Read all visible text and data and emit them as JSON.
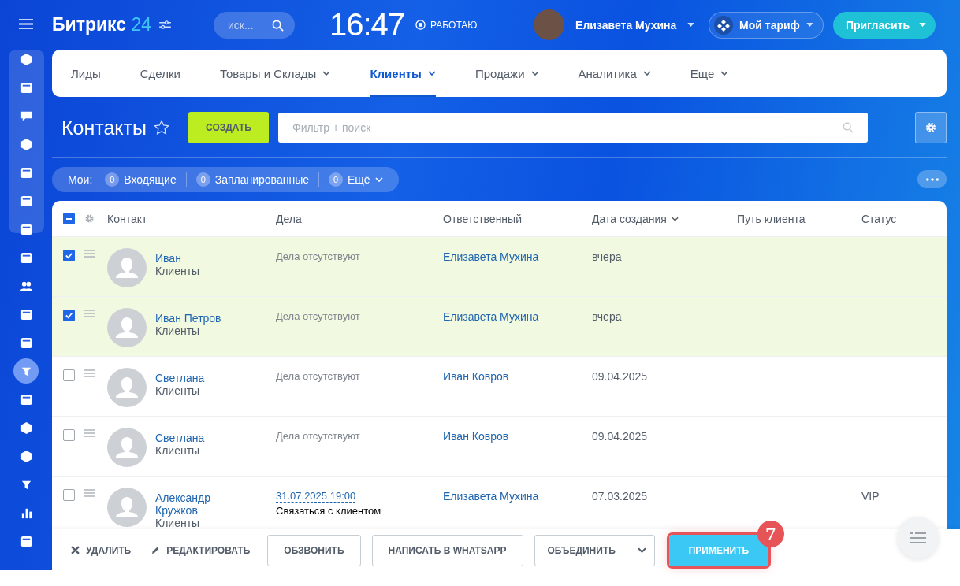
{
  "header": {
    "logo_name": "Битрикс",
    "logo_number": "24",
    "search": {
      "placeholder": "иск..."
    },
    "clock": "16:47",
    "work_status": "РАБОТАЮ",
    "user": {
      "name": "Елизавета Мухина"
    },
    "plan_button": "Мой тариф",
    "invite_button": "Пригласить"
  },
  "sidebar": {
    "items": [
      {
        "selected": false
      },
      {
        "selected": false
      },
      {
        "selected": false
      },
      {
        "selected": false
      },
      {
        "selected": false
      },
      {
        "selected": false
      },
      {
        "selected": false
      },
      {
        "selected": false
      },
      {
        "selected": false
      },
      {
        "selected": false
      },
      {
        "selected": false
      },
      {
        "selected": true
      },
      {
        "selected": false
      },
      {
        "selected": false
      },
      {
        "selected": false
      },
      {
        "selected": false
      },
      {
        "selected": false
      },
      {
        "selected": false
      }
    ]
  },
  "nav_tabs": [
    {
      "label": "Лиды",
      "selected": false,
      "has_menu": false
    },
    {
      "label": "Сделки",
      "selected": false,
      "has_menu": false
    },
    {
      "label": "Товары и Склады",
      "selected": false,
      "has_menu": true
    },
    {
      "label": "Клиенты",
      "selected": true,
      "has_menu": true
    },
    {
      "label": "Продажи",
      "selected": false,
      "has_menu": true
    },
    {
      "label": "Аналитика",
      "selected": false,
      "has_menu": true
    },
    {
      "label": "Еще",
      "selected": false,
      "has_menu": true
    }
  ],
  "page_title": "Контакты",
  "create_button": "СОЗДАТЬ",
  "filter": {
    "placeholder": "Фильтр + поиск"
  },
  "counters": {
    "label": "Мои:",
    "items": [
      {
        "count": "0",
        "label": "Входящие",
        "has_menu": false
      },
      {
        "count": "0",
        "label": "Запланированные",
        "has_menu": false
      },
      {
        "count": "0",
        "label": "Ещё",
        "has_menu": true
      }
    ]
  },
  "table": {
    "header_checkbox": {
      "indeterminate": true
    },
    "columns": [
      {
        "label": "Контакт",
        "sorted": false
      },
      {
        "label": "Дела",
        "sorted": false
      },
      {
        "label": "Ответственный",
        "sorted": false
      },
      {
        "label": "Дата создания",
        "sorted": true
      },
      {
        "label": "Путь клиента",
        "sorted": false
      },
      {
        "label": "Статус",
        "sorted": false
      }
    ],
    "rows": [
      {
        "checked": true,
        "name": "Иван",
        "type": "Клиенты",
        "activity": {
          "kind": "empty",
          "text": "Дела отсутствуют"
        },
        "responsible": "Елизавета Мухина",
        "created": "вчера",
        "status": ""
      },
      {
        "checked": true,
        "name": "Иван Петров",
        "type": "Клиенты",
        "activity": {
          "kind": "empty",
          "text": "Дела отсутствуют"
        },
        "responsible": "Елизавета Мухина",
        "created": "вчера",
        "status": ""
      },
      {
        "checked": false,
        "name": "Светлана",
        "type": "Клиенты",
        "activity": {
          "kind": "empty",
          "text": "Дела отсутствуют"
        },
        "responsible": "Иван Ковров",
        "created": "09.04.2025",
        "status": ""
      },
      {
        "checked": false,
        "name": "Светлана",
        "type": "Клиенты",
        "activity": {
          "kind": "empty",
          "text": "Дела отсутствуют"
        },
        "responsible": "Иван Ковров",
        "created": "09.04.2025",
        "status": ""
      },
      {
        "checked": false,
        "name": "Александр Кружков",
        "type": "Клиенты",
        "activity": {
          "kind": "scheduled",
          "date": "31.07.2025 19:00",
          "text": "Связаться с клиентом"
        },
        "responsible": "Елизавета Мухина",
        "created": "07.03.2025",
        "status": "VIP"
      }
    ]
  },
  "action_bar": {
    "delete": "УДАЛИТЬ",
    "edit": "РЕДАКТИРОВАТЬ",
    "buttons": [
      {
        "kind": "plain",
        "label": "ОБЗВОНИТЬ"
      },
      {
        "kind": "plain",
        "label": "НАПИСАТЬ В WHATSAPP"
      },
      {
        "kind": "dropdown",
        "label": "ОБЪЕДИНИТЬ"
      }
    ],
    "apply": {
      "label": "ПРИМЕНИТЬ",
      "highlighted": true,
      "badge": "7"
    }
  }
}
